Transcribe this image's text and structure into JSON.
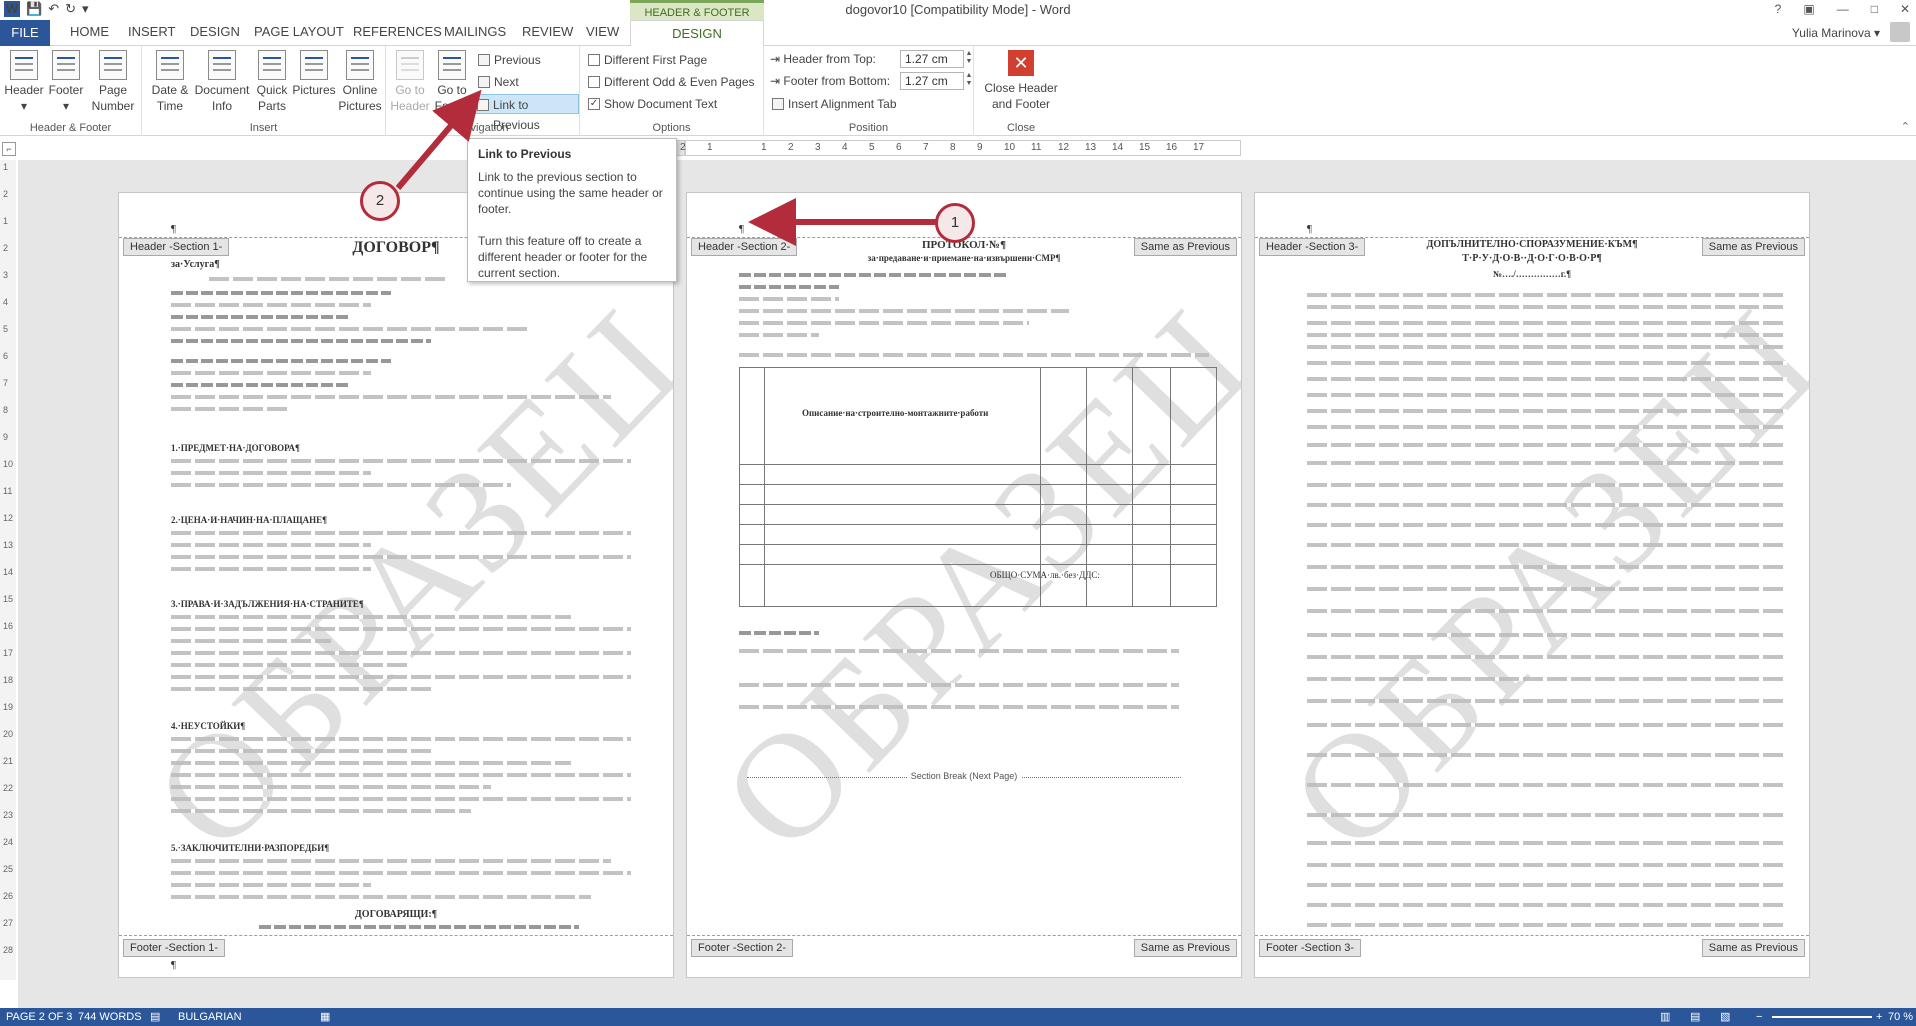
{
  "window": {
    "title": "dogovor10 [Compatibility Mode] - Word",
    "contextual_group": "HEADER & FOOTER TOOLS",
    "controls": [
      "?",
      "▣",
      "—",
      "□",
      "✕"
    ]
  },
  "qat": {
    "save": "💾",
    "undo": "↶",
    "redo": "↻",
    "customize": "▾"
  },
  "tabs": [
    "FILE",
    "HOME",
    "INSERT",
    "DESIGN",
    "PAGE LAYOUT",
    "REFERENCES",
    "MAILINGS",
    "REVIEW",
    "VIEW",
    "DESIGN"
  ],
  "user": {
    "name": "Yulia Marinova ▾"
  },
  "ribbon": {
    "groups": {
      "header_footer": {
        "label": "Header & Footer",
        "header": "Header",
        "footer": "Footer",
        "page_number": "Page\nNumber"
      },
      "insert": {
        "label": "Insert",
        "date_time": "Date &\nTime",
        "document_info": "Document\nInfo",
        "quick_parts": "Quick\nParts",
        "pictures": "Pictures",
        "online_pictures": "Online\nPictures"
      },
      "navigation": {
        "label": "Navigation",
        "go_to_header": "Go to\nHeader",
        "go_to_footer": "Go to\nFooter",
        "previous": "Previous",
        "next": "Next",
        "link_to_previous": "Link to Previous"
      },
      "options": {
        "label": "Options",
        "different_first_page": "Different First Page",
        "different_odd_even": "Different Odd & Even Pages",
        "show_document_text": "Show Document Text"
      },
      "position": {
        "label": "Position",
        "header_from_top_label": "Header from Top:",
        "header_from_top_value": "1.27 cm",
        "footer_from_bottom_label": "Footer from Bottom:",
        "footer_from_bottom_value": "1.27 cm",
        "insert_alignment_tab": "Insert Alignment Tab"
      },
      "close": {
        "label": "Close",
        "close_header_footer": "Close Header\nand Footer"
      }
    }
  },
  "tooltip": {
    "title": "Link to Previous",
    "body1": "Link to the previous section to continue using the same header or footer.",
    "body2": "Turn this feature off to create a different header or footer for the current section."
  },
  "ruler": {
    "marks": [
      "2",
      "1",
      "",
      "1",
      "2",
      "3",
      "4",
      "5",
      "6",
      "7",
      "8",
      "9",
      "10",
      "11",
      "12",
      "13",
      "14",
      "15",
      "16",
      "17"
    ]
  },
  "left_ruler": [
    "1",
    "2",
    "1",
    "2",
    "3",
    "4",
    "5",
    "6",
    "7",
    "8",
    "9",
    "10",
    "11",
    "12",
    "13",
    "14",
    "15",
    "16",
    "17",
    "18",
    "19",
    "20",
    "21",
    "22",
    "23",
    "24",
    "25",
    "26",
    "27",
    "28"
  ],
  "pages": [
    {
      "header_tag": "Header -Section 1-",
      "footer_tag": "Footer -Section 1-",
      "same_as_previous": "",
      "heading": "ДОГОВОР¶",
      "subheading": "за·Услуга¶",
      "sections": [
        "1.·ПРЕДМЕТ·НА·ДОГОВОРА¶",
        "2.·ЦЕНА·И·НАЧИН·НА·ПЛАЩАНЕ¶",
        "3.·ПРАВА·И·ЗАДЪЛЖЕНИЯ·НА·СТРАНИТЕ¶",
        "4.·НЕУСТОЙКИ¶",
        "5.·ЗАКЛЮЧИТЕЛНИ·РАЗПОРЕДБИ¶"
      ],
      "signatures": "ДОГОВАРЯЩИ:¶",
      "watermark": "ОБРАЗЕЦ"
    },
    {
      "header_tag": "Header -Section 2-",
      "footer_tag": "Footer -Section 2-",
      "same_as_previous": "Same as Previous",
      "heading": "ПРОТОКОЛ·№¶",
      "subheading": "за·предаване·и·приемане·на·извършени·СМР¶",
      "table_header": "Описание·на·строително-монтажните·работи",
      "total_label": "ОБЩО·СУМА·лв.·без·ДДС:",
      "section_break": "Section Break (Next Page)",
      "watermark": "ОБРАЗЕЦ"
    },
    {
      "header_tag": "Header -Section 3-",
      "footer_tag": "Footer -Section 3-",
      "same_as_previous": "Same as Previous",
      "heading": "ДОПЪЛНИТЕЛНО·СПОРАЗУМЕНИЕ·КЪМ¶",
      "subheading": "Т·Р·У·Д·О·В··Д·О·Г·О·В·О·Р¶",
      "number_line": "№…./……………г.¶",
      "watermark": "ОБРАЗЕЦ"
    }
  ],
  "callouts": [
    "1",
    "2"
  ],
  "statusbar": {
    "page": "PAGE 2 OF 3",
    "words": "744 WORDS",
    "language": "BULGARIAN",
    "zoom": "70 %"
  },
  "colors": {
    "word_blue": "#2b579a",
    "contextual_green": "#3f6d21",
    "callout_red": "#b32c3b"
  }
}
